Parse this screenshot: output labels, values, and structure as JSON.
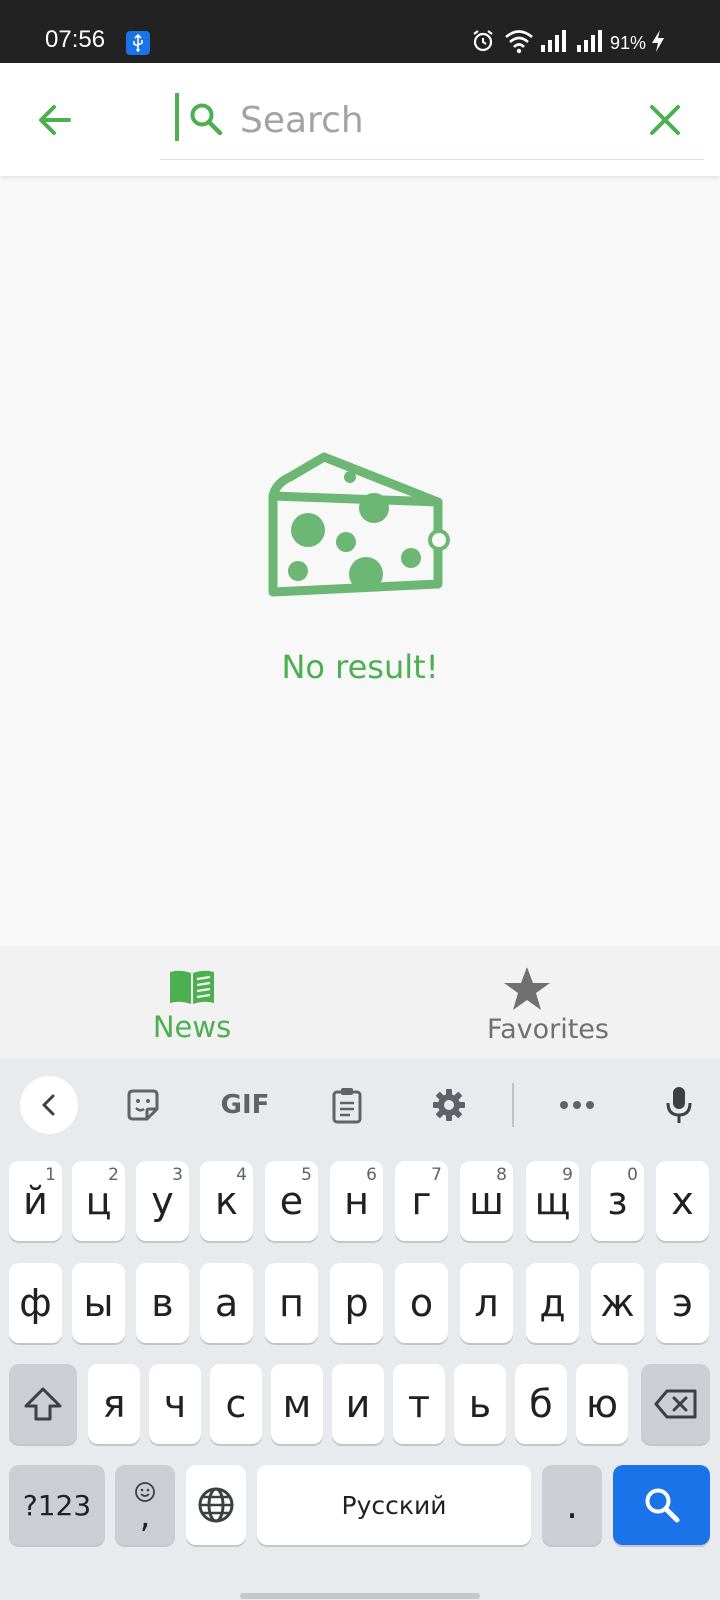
{
  "status_bar": {
    "time": "07:56",
    "battery": "91%",
    "icons": [
      "usb-icon",
      "alarm-icon",
      "wifi-icon",
      "signal-icon",
      "signal-icon",
      "charging-icon"
    ]
  },
  "search": {
    "placeholder": "Search",
    "value": ""
  },
  "empty_state": {
    "message": "No result!",
    "icon": "cheese-icon"
  },
  "bottom_nav": {
    "items": [
      {
        "label": "News",
        "icon": "book-icon",
        "active": true
      },
      {
        "label": "Favorites",
        "icon": "star-icon",
        "active": false
      }
    ]
  },
  "colors": {
    "accent": "#4caf50",
    "inactive": "#707070",
    "keyboard_action": "#1a73e8"
  },
  "keyboard": {
    "toolbar": [
      "back-icon",
      "sticker-icon",
      "gif-icon",
      "clipboard-icon",
      "settings-icon",
      "more-icon",
      "mic-icon"
    ],
    "gif_label": "GIF",
    "row1": [
      "й",
      "ц",
      "у",
      "к",
      "е",
      "н",
      "г",
      "ш",
      "щ",
      "з",
      "х"
    ],
    "row1_hints": [
      "1",
      "2",
      "3",
      "4",
      "5",
      "6",
      "7",
      "8",
      "9",
      "0"
    ],
    "row2": [
      "ф",
      "ы",
      "в",
      "а",
      "п",
      "р",
      "о",
      "л",
      "д",
      "ж",
      "э"
    ],
    "row3": [
      "я",
      "ч",
      "с",
      "м",
      "и",
      "т",
      "ь",
      "б",
      "ю"
    ],
    "symbols_label": "?123",
    "emoji_comma": ",",
    "space_label": "Русский",
    "period": "."
  }
}
